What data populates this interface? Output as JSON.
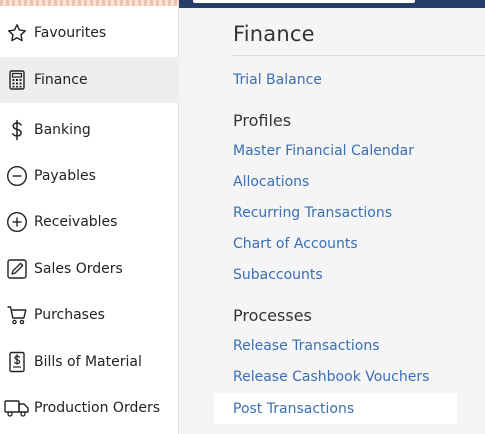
{
  "sidebar": {
    "items": [
      {
        "label": "Favourites",
        "icon": "star-icon"
      },
      {
        "label": "Finance",
        "icon": "calculator-icon",
        "active": true
      },
      {
        "label": "Banking",
        "icon": "dollar-icon"
      },
      {
        "label": "Payables",
        "icon": "minus-circle-icon"
      },
      {
        "label": "Receivables",
        "icon": "plus-circle-icon"
      },
      {
        "label": "Sales Orders",
        "icon": "edit-icon"
      },
      {
        "label": "Purchases",
        "icon": "cart-icon"
      },
      {
        "label": "Bills of Material",
        "icon": "document-dollar-icon"
      },
      {
        "label": "Production Orders",
        "icon": "truck-icon"
      }
    ]
  },
  "main": {
    "title": "Finance",
    "links_top": [
      "Trial Balance"
    ],
    "sections": [
      {
        "title": "Profiles",
        "links": [
          "Master Financial Calendar",
          "Allocations",
          "Recurring Transactions",
          "Chart of Accounts",
          "Subaccounts"
        ]
      },
      {
        "title": "Processes",
        "links": [
          "Release Transactions",
          "Release Cashbook Vouchers",
          "Post Transactions"
        ]
      }
    ]
  },
  "colors": {
    "accent": "#263c6b",
    "link": "#3a6fb4",
    "sidebar_active_bg": "#eeeef0"
  }
}
